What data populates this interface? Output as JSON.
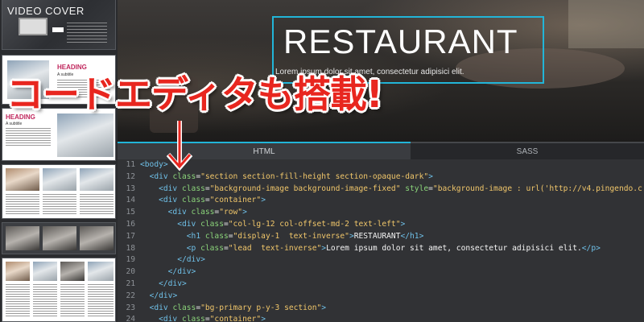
{
  "sidebar": {
    "video_label": "VIDEO COVER",
    "heading_label": "HEADING",
    "subtitle_label": "A subtitle"
  },
  "hero": {
    "title": "RESTAURANT",
    "lead": "Lorem ipsum dolor sit amet, consectetur adipisici elit."
  },
  "overlay": {
    "caption": "コードエディタも搭載!"
  },
  "editor": {
    "tabs": [
      "HTML",
      "SASS"
    ],
    "active_tab": "HTML",
    "accent_color": "#22b5d8",
    "lines": [
      {
        "n": "11",
        "indent": 0,
        "tag": "<body>",
        "attrs": [],
        "text": ""
      },
      {
        "n": "12",
        "indent": 1,
        "tag": "<div",
        "attrs": [
          {
            "name": " class",
            "value": "\"section section-fill-height section-opaque-dark\""
          }
        ],
        "close": ">",
        "text": ""
      },
      {
        "n": "13",
        "indent": 2,
        "tag": "<div",
        "attrs": [
          {
            "name": " class",
            "value": "\"background-image background-image-fixed\""
          },
          {
            "name": " style",
            "value": "\"background-image : url('http://v4.pingendo.c"
          }
        ],
        "close": "",
        "text": ""
      },
      {
        "n": "14",
        "indent": 2,
        "tag": "<div",
        "attrs": [
          {
            "name": " class",
            "value": "\"container\""
          }
        ],
        "close": ">",
        "text": ""
      },
      {
        "n": "15",
        "indent": 3,
        "tag": "<div",
        "attrs": [
          {
            "name": " class",
            "value": "\"row\""
          }
        ],
        "close": ">",
        "text": ""
      },
      {
        "n": "16",
        "indent": 4,
        "tag": "<div",
        "attrs": [
          {
            "name": " class",
            "value": "\"col-lg-12 col-offset-md-2 text-left\""
          }
        ],
        "close": ">",
        "text": ""
      },
      {
        "n": "17",
        "indent": 5,
        "tag": "<h1",
        "attrs": [
          {
            "name": " class",
            "value": "\"display-1  text-inverse\""
          }
        ],
        "close": ">",
        "text": "RESTAURANT",
        "end": "</h1>"
      },
      {
        "n": "18",
        "indent": 5,
        "tag": "<p",
        "attrs": [
          {
            "name": " class",
            "value": "\"lead  text-inverse\""
          }
        ],
        "close": ">",
        "text": "Lorem ipsum dolor sit amet, consectetur adipisici elit.",
        "end": "</p>"
      },
      {
        "n": "19",
        "indent": 4,
        "tag": "</div>",
        "attrs": [],
        "text": ""
      },
      {
        "n": "20",
        "indent": 3,
        "tag": "</div>",
        "attrs": [],
        "text": ""
      },
      {
        "n": "21",
        "indent": 2,
        "tag": "</div>",
        "attrs": [],
        "text": ""
      },
      {
        "n": "22",
        "indent": 1,
        "tag": "</div>",
        "attrs": [],
        "text": ""
      },
      {
        "n": "23",
        "indent": 1,
        "tag": "<div",
        "attrs": [
          {
            "name": " class",
            "value": "\"bg-primary p-y-3 section\""
          }
        ],
        "close": ">",
        "text": ""
      },
      {
        "n": "24",
        "indent": 2,
        "tag": "<div",
        "attrs": [
          {
            "name": " class",
            "value": "\"container\""
          }
        ],
        "close": ">",
        "text": ""
      }
    ]
  }
}
